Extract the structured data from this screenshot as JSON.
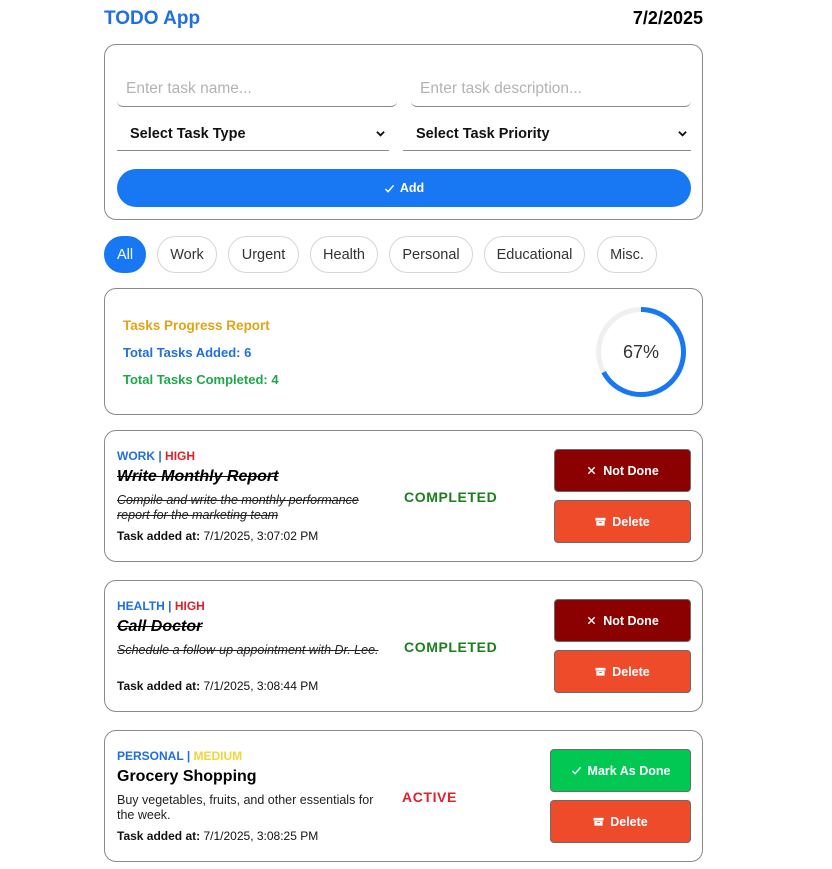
{
  "header": {
    "title": "TODO App",
    "date": "7/2/2025"
  },
  "form": {
    "name_placeholder": "Enter task name...",
    "desc_placeholder": "Enter task description...",
    "type_select": "Select Task Type",
    "priority_select": "Select Task Priority",
    "add_label": "Add"
  },
  "filters": [
    {
      "label": "All",
      "active": true
    },
    {
      "label": "Work"
    },
    {
      "label": "Urgent"
    },
    {
      "label": "Health"
    },
    {
      "label": "Personal"
    },
    {
      "label": "Educational"
    },
    {
      "label": "Misc."
    }
  ],
  "report": {
    "title": "Tasks Progress Report",
    "added": "Total Tasks Added: 6",
    "completed": "Total Tasks Completed: 4",
    "percent_label": "67%",
    "percent": 67
  },
  "tasks": [
    {
      "type": "WORK",
      "sep": "|",
      "priority": "HIGH",
      "title": "Write Monthly Report",
      "description": "Compile and write the monthly performance report for the marketing team",
      "added_label": "Task added at:",
      "added_at": "7/1/2025, 3:07:02 PM",
      "status": "COMPLETED",
      "toggle_label": "Not Done",
      "delete_label": "Delete"
    },
    {
      "type": "HEALTH",
      "sep": "|",
      "priority": "HIGH",
      "title": "Call Doctor",
      "description": "Schedule a follow-up appointment with Dr. Lee.",
      "added_label": "Task added at:",
      "added_at": "7/1/2025, 3:08:44 PM",
      "status": "COMPLETED",
      "toggle_label": "Not Done",
      "delete_label": "Delete"
    },
    {
      "type": "PERSONAL",
      "sep": "|",
      "priority": "MEDIUM",
      "title": "Grocery Shopping",
      "description": "Buy vegetables, fruits, and other essentials for the week.",
      "added_label": "Task added at:",
      "added_at": "7/1/2025, 3:08:25 PM",
      "status": "ACTIVE",
      "toggle_label": "Mark As Done",
      "delete_label": "Delete"
    }
  ],
  "colors": {
    "accent": "#1877f2",
    "not_done": "#8b0000",
    "delete": "#ee4b2b",
    "mark_done": "#00c853",
    "completed": "#1b7f1b",
    "active": "#e0202a"
  }
}
